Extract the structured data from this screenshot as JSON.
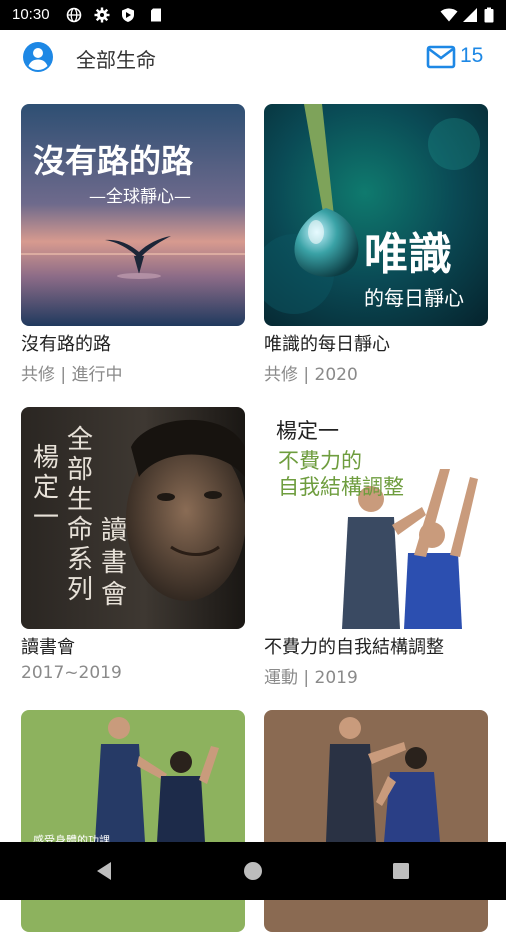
{
  "status_bar": {
    "time": "10:30",
    "left_icons": [
      "globe-icon",
      "gear-icon",
      "shield-icon",
      "sd-card-icon"
    ],
    "right_icons": [
      "wifi-icon",
      "signal-icon",
      "battery-icon"
    ]
  },
  "app_bar": {
    "title": "全部生命",
    "mail_count": "15",
    "accent": "#1e88e5"
  },
  "programs": [
    {
      "title": "沒有路的路",
      "subtitle": "共修 | 進行中",
      "cover": {
        "heading": "沒有路的路",
        "tagline": "—全球靜心—"
      }
    },
    {
      "title": "唯識的每日靜心",
      "subtitle": "共修 | 2020",
      "cover": {
        "heading": "唯識",
        "tagline": "的每日靜心"
      }
    },
    {
      "title": "讀書會",
      "subtitle": "2017~2019",
      "cover": {
        "col1": "楊定一",
        "col2": "全部生命系列",
        "col3": "讀書會"
      }
    },
    {
      "title": "不費力的自我結構調整",
      "subtitle": "運動 | 2019",
      "cover": {
        "author": "楊定一",
        "line1": "不費力的",
        "line2": "自我結構調整"
      }
    },
    {
      "title": "",
      "subtitle": "",
      "cover": {
        "caption": "感受身體的功課"
      }
    },
    {
      "title": "",
      "subtitle": "",
      "cover": {}
    }
  ],
  "nav_bar": {
    "buttons": [
      "back-icon",
      "home-icon",
      "recents-icon"
    ]
  }
}
